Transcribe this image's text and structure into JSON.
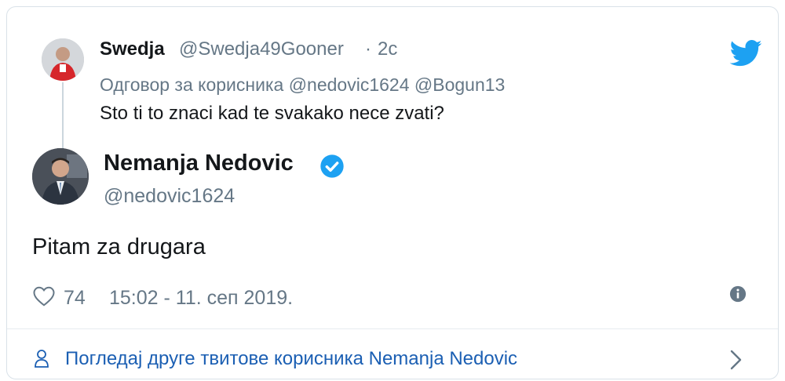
{
  "reply_tweet": {
    "author_name": "Swedja",
    "author_handle": "@Swedja49Gooner",
    "separator": "·",
    "time_ago": "2с",
    "reply_to_prefix": "Одговор за корисника",
    "reply_to_mentions": "@nedovic1624 @Bogun13",
    "text": "Sto ti to znaci kad te svakako nece zvati?"
  },
  "main_tweet": {
    "author_name": "Nemanja Nedovic",
    "author_handle": "@nedovic1624",
    "verified": true,
    "text": "Pitam za drugara",
    "like_count": "74",
    "timestamp": "15:02 - 11. сеп 2019."
  },
  "footer": {
    "link_text": "Погледај друге твитове корисника Nemanja Nedovic"
  },
  "colors": {
    "twitter_blue": "#1da1f2",
    "link_blue": "#1b5fb3",
    "muted_gray": "#657786",
    "text_dark": "#14171a"
  },
  "icons": [
    "twitter-logo-icon",
    "verified-badge-icon",
    "heart-icon",
    "info-icon",
    "person-icon",
    "chevron-right-icon"
  ]
}
